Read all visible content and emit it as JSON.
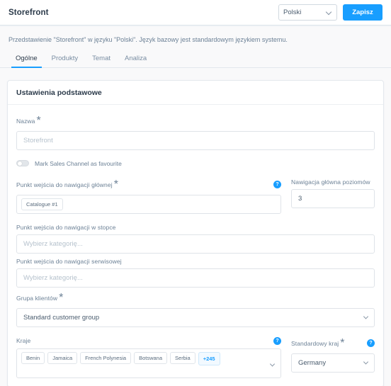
{
  "header": {
    "title": "Storefront",
    "language_select": {
      "value": "Polski",
      "chevron_icon": "chevron-down-icon"
    },
    "save_label": "Zapisz"
  },
  "description": "Przedstawienie \"Storefront\" w języku \"Polski\". Język bazowy jest standardowym językiem systemu.",
  "tabs": [
    {
      "label": "Ogólne",
      "active": true
    },
    {
      "label": "Produkty",
      "active": false
    },
    {
      "label": "Temat",
      "active": false
    },
    {
      "label": "Analiza",
      "active": false
    }
  ],
  "card": {
    "title": "Ustawienia podstawowe",
    "fields": {
      "name": {
        "label": "Nazwa",
        "required": "*",
        "value": "",
        "placeholder": "Storefront"
      },
      "favourite_toggle": {
        "label": "Mark Sales Channel as favourite",
        "state": "off"
      },
      "main_navigation_entry": {
        "label": "Punkt wejścia do nawigacji głównej",
        "required": "*",
        "help_icon": "help-icon",
        "help_glyph": "?",
        "tags": [
          "Catalogue #1"
        ]
      },
      "main_navigation_levels": {
        "label": "Nawigacja główna poziomów",
        "value": "3"
      },
      "footer_navigation_entry": {
        "label": "Punkt wejścia do nawigacji w stopce",
        "placeholder": "Wybierz kategorię..."
      },
      "service_navigation_entry": {
        "label": "Punkt wejścia do nawigacji serwisowej",
        "placeholder": "Wybierz kategorię..."
      },
      "customer_group": {
        "label": "Grupa klientów",
        "required": "*",
        "value": "Standard customer group",
        "chevron_icon": "chevron-down-icon"
      },
      "countries": {
        "label": "Kraje",
        "help_icon": "help-icon",
        "help_glyph": "?",
        "tags": [
          "Benin",
          "Jamaica",
          "French Polynesia",
          "Botswana",
          "Serbia"
        ],
        "more_label": "+245"
      },
      "default_country": {
        "label": "Standardowy kraj",
        "required": "*",
        "help_icon": "help-icon",
        "help_glyph": "?",
        "value": "Germany",
        "chevron_icon": "chevron-down-icon"
      }
    }
  },
  "colors": {
    "accent": "#189eff",
    "page_bg": "#f9f9fa",
    "card_bg": "#ffffff",
    "text": "#52667a",
    "label": "#6c8196",
    "border": "#dfe3e8"
  }
}
